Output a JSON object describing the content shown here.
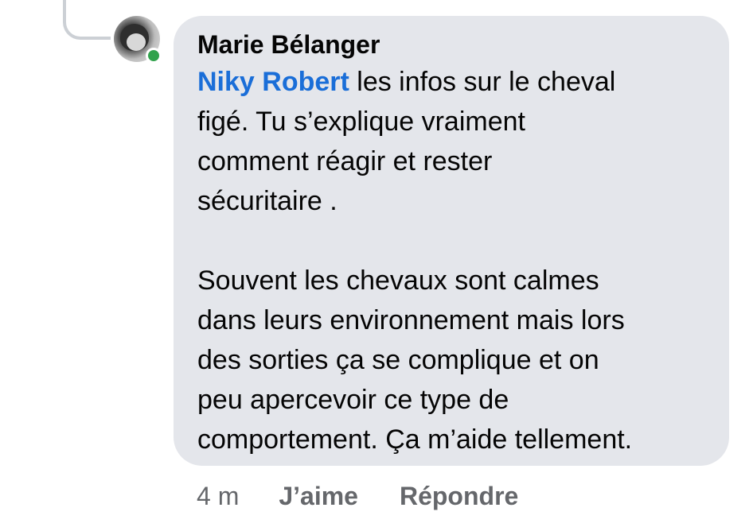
{
  "comment": {
    "author": "Marie Bélanger",
    "mention": "Niky Robert",
    "paragraph1": " les infos sur le cheval\nfigé. Tu s’explique vraiment\ncomment réagir et rester\nsécuritaire .",
    "paragraph2": "Souvent les chevaux sont calmes\ndans leurs environnement mais lors\ndes sorties ça se complique et on\npeu apercevoir ce type de\ncomportement. Ça m’aide tellement.",
    "timestamp": "4 m",
    "like_label": "J’aime",
    "reply_label": "Répondre",
    "online": true
  },
  "colors": {
    "bubble": "#e4e6eb",
    "mention": "#1a6ed8",
    "meta": "#65676b",
    "online": "#31a24c"
  }
}
